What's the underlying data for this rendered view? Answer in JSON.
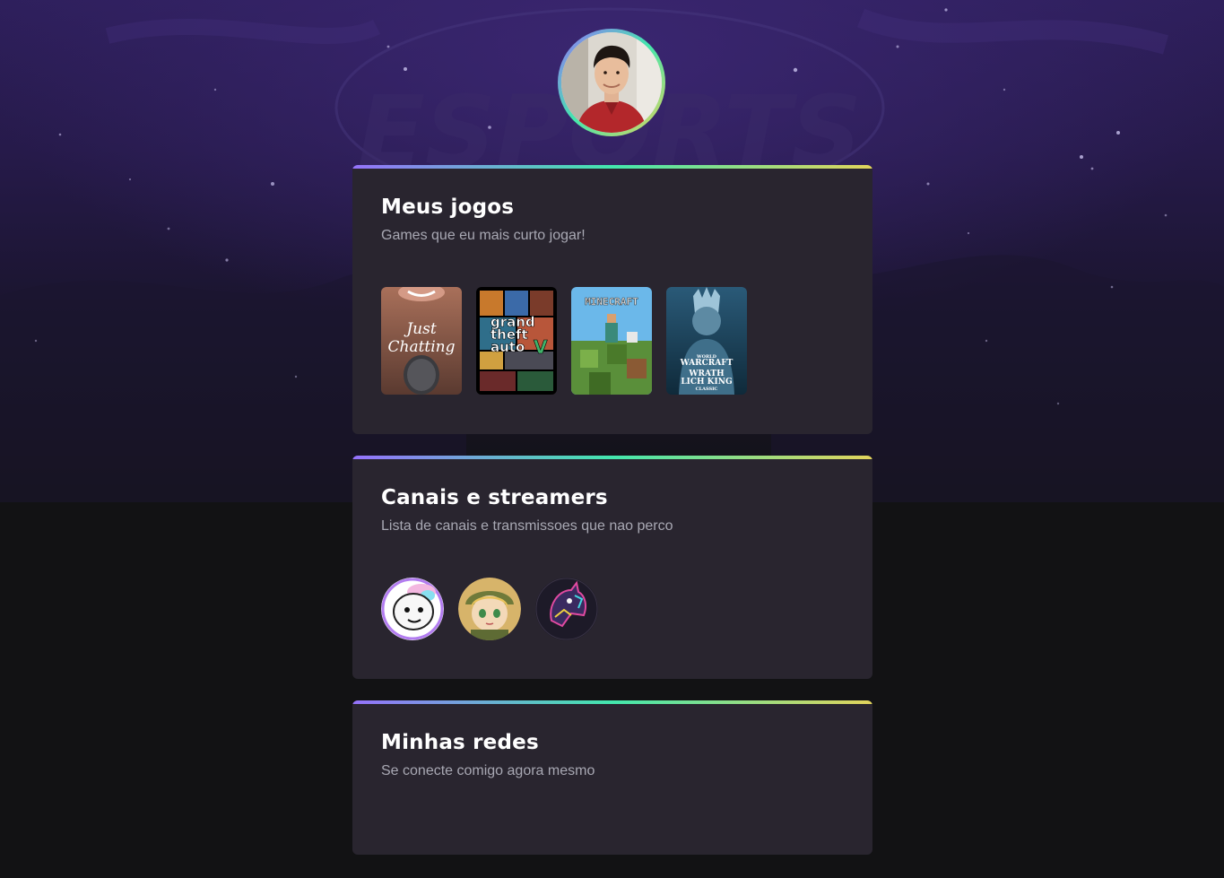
{
  "background": {
    "watermark": "ESPORTS"
  },
  "profile": {
    "avatar_label": "profile-photo"
  },
  "sections": {
    "games": {
      "title": "Meus jogos",
      "subtitle": "Games que eu mais curto jogar!",
      "items": [
        {
          "label": "Just Chatting",
          "lines": [
            "Just",
            "Chatting"
          ]
        },
        {
          "label": "Grand Theft Auto V",
          "lines": [
            "grand",
            "theft",
            "auto",
            "V"
          ]
        },
        {
          "label": "Minecraft",
          "lines": [
            "MINECRAFT"
          ]
        },
        {
          "label": "World of Warcraft: Wrath of the Lich King Classic",
          "lines": [
            "WORLD",
            "WARCRAFT",
            "WRATH",
            "LICH KING",
            "CLASSIC"
          ]
        }
      ]
    },
    "streamers": {
      "title": "Canais e streamers",
      "subtitle": "Lista de canais e transmissoes que nao perco"
    },
    "social": {
      "title": "Minhas redes",
      "subtitle": "Se conecte comigo agora mesmo"
    }
  },
  "colors": {
    "accent_purple": "#9572fc",
    "accent_green": "#43e7ad",
    "accent_yellow": "#e2d45c",
    "card": "#29252f",
    "page": "#121214"
  }
}
